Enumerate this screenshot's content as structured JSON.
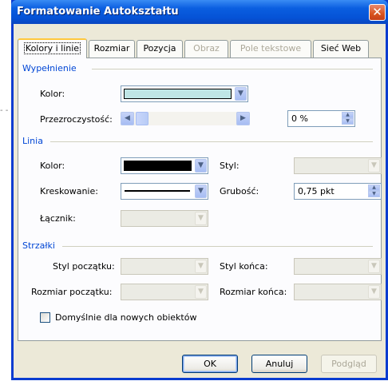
{
  "dialog": {
    "title": "Formatowanie Autokształtu",
    "close_glyph": "✕"
  },
  "outside_mark": "- -",
  "tabs": [
    {
      "label": "Kolory i linie",
      "active": true,
      "enabled": true
    },
    {
      "label": "Rozmiar",
      "active": false,
      "enabled": true
    },
    {
      "label": "Pozycja",
      "active": false,
      "enabled": true
    },
    {
      "label": "Obraz",
      "active": false,
      "enabled": false
    },
    {
      "label": "Pole tekstowe",
      "active": false,
      "enabled": false
    },
    {
      "label": "Sieć Web",
      "active": false,
      "enabled": true
    }
  ],
  "fill": {
    "section_title": "Wypełnienie",
    "color_label": "Kolor:",
    "color_value": "#bfe5e5",
    "transparency_label": "Przezroczystość:",
    "transparency_value": "0 %",
    "transparency_fraction": 0
  },
  "line": {
    "section_title": "Linia",
    "color_label": "Kolor:",
    "color_value": "#000000",
    "dash_label": "Kreskowanie:",
    "connector_label": "Łącznik:",
    "style_label": "Styl:",
    "weight_label": "Grubość:",
    "weight_value": "0,75 pkt"
  },
  "arrows": {
    "section_title": "Strzałki",
    "begin_style_label": "Styl początku:",
    "end_style_label": "Styl końca:",
    "begin_size_label": "Rozmiar początku:",
    "end_size_label": "Rozmiar końca:"
  },
  "defaults_checkbox": {
    "label": "Domyślnie dla nowych obiektów",
    "checked": false
  },
  "buttons": {
    "ok": "OK",
    "cancel": "Anuluj",
    "preview": "Podgląd"
  },
  "colors": {
    "title_bar": "#0552d6",
    "section_heading": "#0046d5",
    "dialog_face": "#ece9d8",
    "close_button": "#d9541e"
  },
  "icons": {
    "dropdown": "chevron-down-icon",
    "spin": "spin-up-down-icon",
    "scroll_left": "arrow-left-icon",
    "scroll_right": "arrow-right-icon"
  }
}
